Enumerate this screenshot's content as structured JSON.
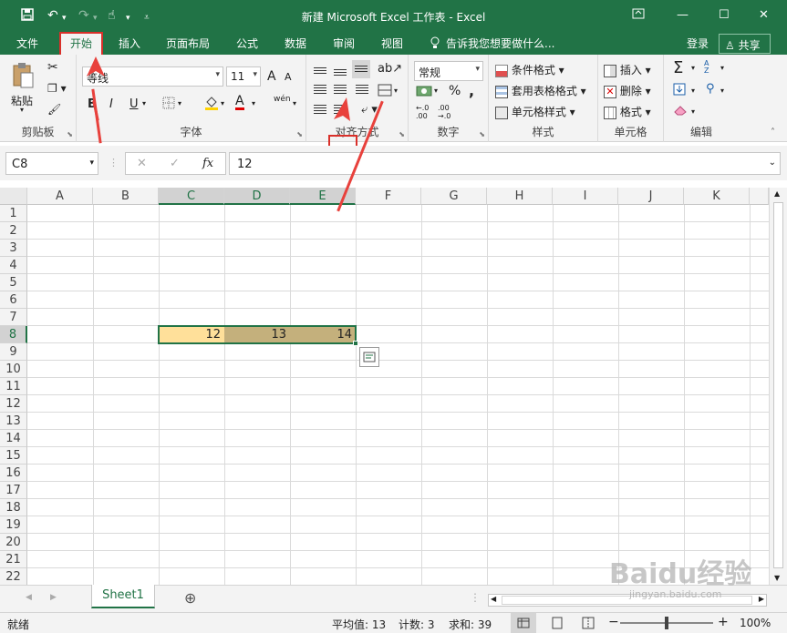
{
  "window": {
    "title": "新建 Microsoft Excel 工作表 - Excel",
    "icons": [
      "save-icon",
      "undo-icon",
      "redo-icon",
      "touch-mode-icon",
      "customize-icon"
    ],
    "controls": [
      "ribbon-display-icon",
      "minimize-icon",
      "maximize-icon",
      "close-icon"
    ]
  },
  "menu": {
    "tabs": [
      "文件",
      "开始",
      "插入",
      "页面布局",
      "公式",
      "数据",
      "审阅",
      "视图"
    ],
    "active_tab": "开始",
    "tell_me": "告诉我您想要做什么...",
    "login": "登录",
    "share": "共享"
  },
  "ribbon": {
    "clipboard": {
      "label": "剪贴板",
      "paste": "粘贴"
    },
    "font": {
      "label": "字体",
      "font_name": "等线",
      "font_size": "11",
      "bold": "B",
      "italic": "I",
      "underline": "U",
      "grow": "A",
      "shrink": "A",
      "color_a": "A",
      "phonetic": "wén"
    },
    "alignment": {
      "label": "对齐方式"
    },
    "number": {
      "label": "数字",
      "format": "常规",
      "percent": "%",
      "comma": ",",
      "inc_decimal": "←.0 .00",
      "dec_decimal": ".00 →.0"
    },
    "styles": {
      "label": "样式",
      "conditional": "条件格式",
      "table": "套用表格格式",
      "cell": "单元格样式"
    },
    "cells": {
      "label": "单元格",
      "insert": "插入",
      "delete": "删除",
      "format": "格式"
    },
    "editing": {
      "label": "编辑",
      "sum": "Σ",
      "sort": "A Z"
    }
  },
  "formula_bar": {
    "name_box": "C8",
    "cancel": "✕",
    "enter": "✓",
    "fx": "fx",
    "content": "12"
  },
  "sheet": {
    "columns": [
      "A",
      "B",
      "C",
      "D",
      "E",
      "F",
      "G",
      "H",
      "I",
      "J",
      "K"
    ],
    "rows": [
      "1",
      "2",
      "3",
      "4",
      "5",
      "6",
      "7",
      "8",
      "9",
      "10",
      "11",
      "12",
      "13",
      "14",
      "15",
      "16",
      "17",
      "18",
      "19",
      "20",
      "21",
      "22"
    ],
    "selected_columns": [
      "C",
      "D",
      "E"
    ],
    "selected_row": "8",
    "cells": {
      "C8": "12",
      "D8": "13",
      "E8": "14"
    },
    "colors": {
      "c8": "#ffe09a",
      "de8": "#c4b07c",
      "accent": "#217346",
      "arrow": "#e8413c"
    }
  },
  "tabs": {
    "sheet": "Sheet1",
    "add": "⊕"
  },
  "status": {
    "ready": "就绪",
    "average": "平均值: 13",
    "count": "计数: 3",
    "sum": "求和: 39",
    "zoom": "100%",
    "minus": "−",
    "plus": "+"
  },
  "watermark": {
    "brand": "Baidu经验",
    "url": "jingyan.baidu.com"
  }
}
